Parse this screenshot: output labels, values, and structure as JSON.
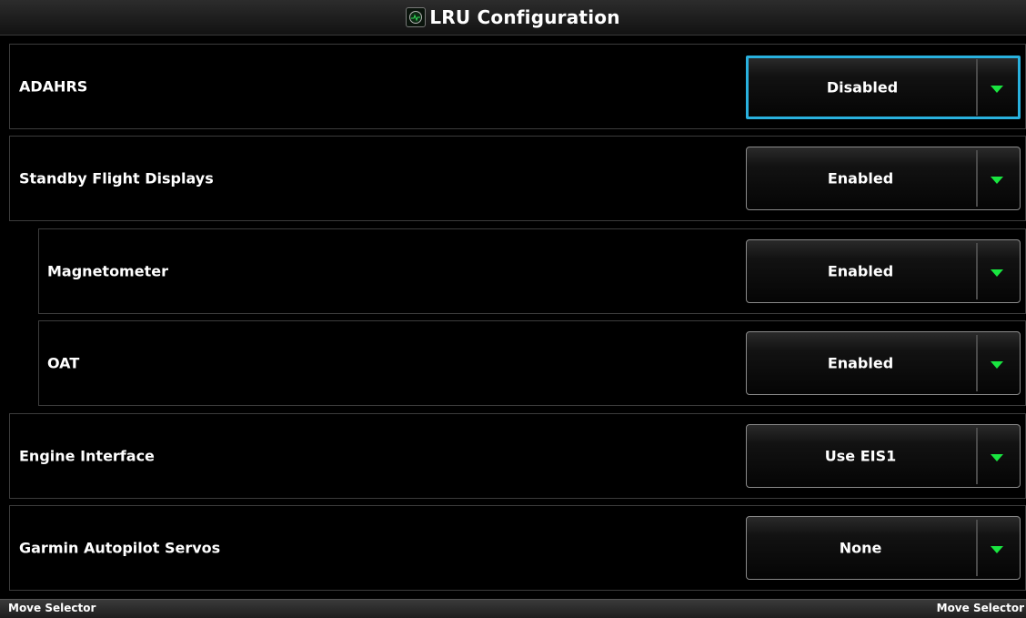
{
  "header": {
    "title": "LRU Configuration",
    "icon": "gauge-icon"
  },
  "rows": [
    {
      "label": "ADAHRS",
      "value": "Disabled",
      "selected": true
    },
    {
      "label": "Standby Flight Displays",
      "value": "Enabled"
    },
    {
      "label": "Magnetometer",
      "value": "Enabled"
    },
    {
      "label": "OAT",
      "value": "Enabled"
    },
    {
      "label": "Engine Interface",
      "value": "Use EIS1"
    },
    {
      "label": "Garmin Autopilot Servos",
      "value": "None"
    }
  ],
  "softkeys": {
    "left": "Move Selector",
    "right": "Move Selector"
  },
  "colors": {
    "selection_border": "#29b1de",
    "dropdown_arrow": "#19e640",
    "background": "#000000"
  }
}
